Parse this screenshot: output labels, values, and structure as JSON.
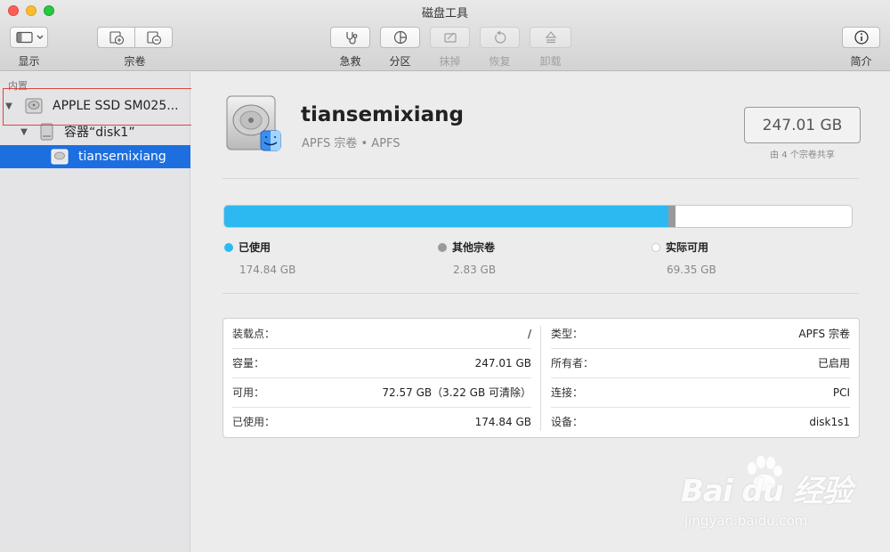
{
  "window": {
    "title": "磁盘工具"
  },
  "toolbar": {
    "view_label": "显示",
    "volume_label": "宗卷",
    "first_aid_label": "急救",
    "partition_label": "分区",
    "erase_label": "抹掉",
    "restore_label": "恢复",
    "unmount_label": "卸载",
    "info_label": "简介"
  },
  "sidebar": {
    "section": "内置",
    "items": [
      {
        "label": "APPLE SSD SM025..."
      },
      {
        "label": "容器“disk1”"
      },
      {
        "label": "tiansemixiang"
      }
    ]
  },
  "volume": {
    "name": "tiansemixiang",
    "subtitle": "APFS 宗卷 • APFS",
    "capacity": "247.01 GB",
    "shared_note": "由 4 个宗卷共享"
  },
  "usage": {
    "used": {
      "label": "已使用",
      "value": "174.84 GB",
      "fraction": 0.7078,
      "color": "#2cb9f2"
    },
    "other": {
      "label": "其他宗卷",
      "value": "2.83 GB",
      "fraction": 0.0115,
      "color": "#9a9a9a"
    },
    "available": {
      "label": "实际可用",
      "value": "69.35 GB",
      "color": "#ffffff"
    }
  },
  "info": {
    "left": [
      {
        "key": "装载点：",
        "value": "/"
      },
      {
        "key": "容量：",
        "value": "247.01 GB"
      },
      {
        "key": "可用：",
        "value": "72.57 GB（3.22 GB 可清除）"
      },
      {
        "key": "已使用：",
        "value": "174.84 GB"
      }
    ],
    "right": [
      {
        "key": "类型：",
        "value": "APFS 宗卷"
      },
      {
        "key": "所有者：",
        "value": "已启用"
      },
      {
        "key": "连接：",
        "value": "PCI"
      },
      {
        "key": "设备：",
        "value": "disk1s1"
      }
    ]
  },
  "watermark": {
    "brand": "Bai du 经验",
    "url": "jingyan.baidu.com"
  }
}
